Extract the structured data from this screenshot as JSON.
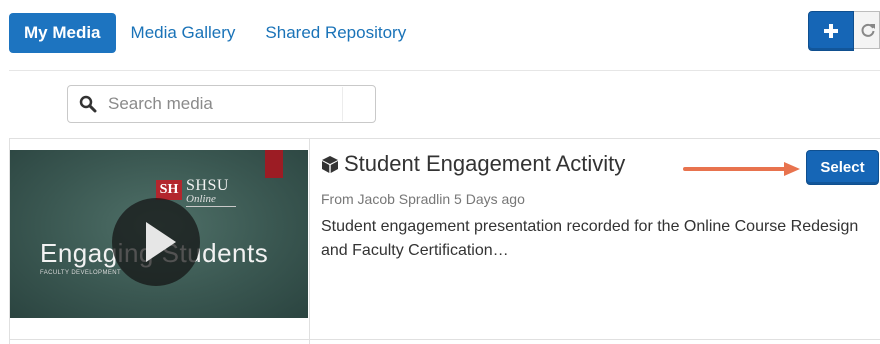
{
  "tabs": [
    {
      "label": "My Media",
      "active": true
    },
    {
      "label": "Media Gallery",
      "active": false
    },
    {
      "label": "Shared Repository",
      "active": false
    }
  ],
  "toolbar": {
    "add_icon": "plus-icon",
    "refresh_icon": "refresh-icon"
  },
  "search": {
    "placeholder": "Search media",
    "value": "",
    "icon": "search-icon"
  },
  "media_item": {
    "type_icon": "cube-icon",
    "title": "Student Engagement Activity",
    "meta": "From Jacob Spradlin 5 Days ago",
    "description": "Student engagement presentation recorded for the Online Course Redesign and Faculty Certification…",
    "select_label": "Select",
    "thumbnail": {
      "logo_badge": "SH",
      "logo_name": "SHSU",
      "logo_sub": "Online",
      "title": "Engaging Students",
      "subtitle": "FACULTY DEVELOPMENT"
    }
  },
  "colors": {
    "accent": "#1d74c0",
    "button": "#1666b6",
    "link": "#1a73b8",
    "annotation_arrow": "#e8734e"
  }
}
